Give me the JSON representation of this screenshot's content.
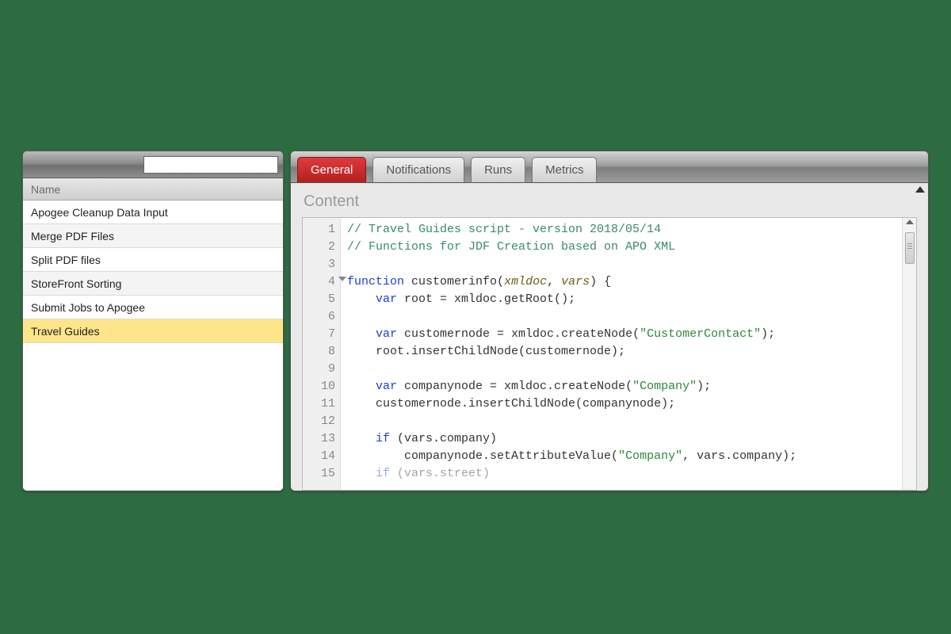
{
  "sidebar": {
    "column_header": "Name",
    "search_placeholder": "",
    "items": [
      {
        "label": "Apogee Cleanup Data Input",
        "selected": false
      },
      {
        "label": "Merge PDF Files",
        "selected": false
      },
      {
        "label": "Split PDF files",
        "selected": false
      },
      {
        "label": "StoreFront Sorting",
        "selected": false
      },
      {
        "label": "Submit Jobs to Apogee",
        "selected": false
      },
      {
        "label": "Travel Guides",
        "selected": true
      }
    ]
  },
  "tabs": [
    {
      "label": "General",
      "active": true
    },
    {
      "label": "Notifications",
      "active": false
    },
    {
      "label": "Runs",
      "active": false
    },
    {
      "label": "Metrics",
      "active": false
    }
  ],
  "content": {
    "heading": "Content",
    "code_lines": [
      {
        "n": 1,
        "fold": false,
        "tokens": [
          {
            "t": "// Travel Guides script - version 2018/05/14",
            "c": "comment"
          }
        ]
      },
      {
        "n": 2,
        "fold": false,
        "tokens": [
          {
            "t": "// Functions for JDF Creation based on APO XML",
            "c": "comment"
          }
        ]
      },
      {
        "n": 3,
        "fold": false,
        "tokens": []
      },
      {
        "n": 4,
        "fold": true,
        "tokens": [
          {
            "t": "function ",
            "c": "keyword"
          },
          {
            "t": "customerinfo",
            "c": "func"
          },
          {
            "t": "(",
            "c": "ident"
          },
          {
            "t": "xmldoc",
            "c": "param"
          },
          {
            "t": ", ",
            "c": "ident"
          },
          {
            "t": "vars",
            "c": "param"
          },
          {
            "t": ") {",
            "c": "ident"
          }
        ]
      },
      {
        "n": 5,
        "fold": false,
        "tokens": [
          {
            "t": "    ",
            "c": "ident"
          },
          {
            "t": "var ",
            "c": "keyword"
          },
          {
            "t": "root = xmldoc.getRoot();",
            "c": "ident"
          }
        ]
      },
      {
        "n": 6,
        "fold": false,
        "tokens": []
      },
      {
        "n": 7,
        "fold": false,
        "tokens": [
          {
            "t": "    ",
            "c": "ident"
          },
          {
            "t": "var ",
            "c": "keyword"
          },
          {
            "t": "customernode = xmldoc.createNode(",
            "c": "ident"
          },
          {
            "t": "\"CustomerContact\"",
            "c": "string"
          },
          {
            "t": ");",
            "c": "ident"
          }
        ]
      },
      {
        "n": 8,
        "fold": false,
        "tokens": [
          {
            "t": "    root.insertChildNode(customernode);",
            "c": "ident"
          }
        ]
      },
      {
        "n": 9,
        "fold": false,
        "tokens": []
      },
      {
        "n": 10,
        "fold": false,
        "tokens": [
          {
            "t": "    ",
            "c": "ident"
          },
          {
            "t": "var ",
            "c": "keyword"
          },
          {
            "t": "companynode = xmldoc.createNode(",
            "c": "ident"
          },
          {
            "t": "\"Company\"",
            "c": "string"
          },
          {
            "t": ");",
            "c": "ident"
          }
        ]
      },
      {
        "n": 11,
        "fold": false,
        "tokens": [
          {
            "t": "    customernode.insertChildNode(companynode);",
            "c": "ident"
          }
        ]
      },
      {
        "n": 12,
        "fold": false,
        "tokens": []
      },
      {
        "n": 13,
        "fold": false,
        "tokens": [
          {
            "t": "    ",
            "c": "ident"
          },
          {
            "t": "if ",
            "c": "keyword"
          },
          {
            "t": "(vars.company)",
            "c": "ident"
          }
        ]
      },
      {
        "n": 14,
        "fold": false,
        "tokens": [
          {
            "t": "        companynode.setAttributeValue(",
            "c": "ident"
          },
          {
            "t": "\"Company\"",
            "c": "string"
          },
          {
            "t": ", vars.company);",
            "c": "ident"
          }
        ]
      },
      {
        "n": 15,
        "fold": false,
        "faded": true,
        "tokens": [
          {
            "t": "    ",
            "c": "ident"
          },
          {
            "t": "if ",
            "c": "keyword"
          },
          {
            "t": "(vars.street)",
            "c": "ident"
          }
        ]
      }
    ]
  },
  "colors": {
    "accent_red": "#c42a2a",
    "selection_yellow": "#ffe58a"
  }
}
